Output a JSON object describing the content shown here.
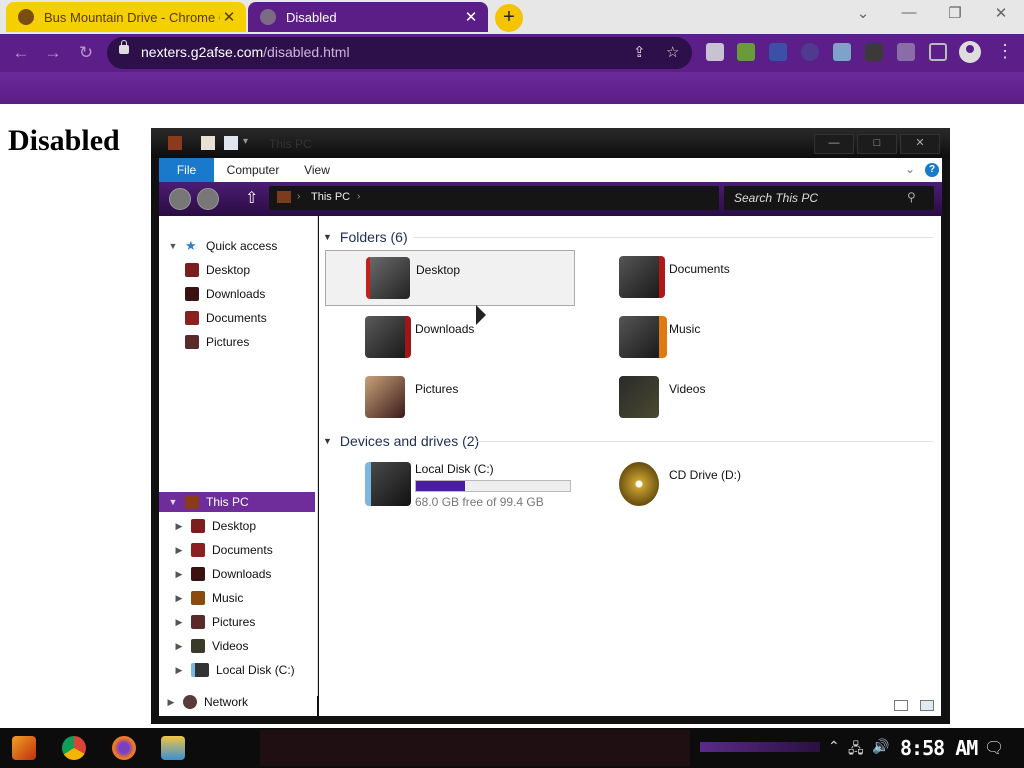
{
  "browser": {
    "tabs": [
      {
        "title": "Bus Mountain Drive - Chrome 6",
        "close": "✕"
      },
      {
        "title": "Disabled",
        "close": "✕"
      }
    ],
    "new_tab": "+",
    "window_controls": {
      "dropdown": "⌄",
      "minimize": "—",
      "restore": "❐",
      "close": "✕"
    },
    "nav": {
      "back": "←",
      "forward": "→",
      "reload": "↻"
    },
    "url_host": "nexters.g2afse.com",
    "url_path": "/disabled.html",
    "omnibox_icons": {
      "share": "⇪",
      "bookmark": "☆"
    },
    "colors": {
      "active_tab": "#5b1e87",
      "inactive_tab": "#f5d000",
      "toolbar": "#5c1f8a"
    }
  },
  "page": {
    "heading": "Disabled"
  },
  "explorer": {
    "title": "This PC",
    "window_buttons": {
      "minimize": "—",
      "maximize": "□",
      "close": "✕"
    },
    "ribbon_tabs": [
      "File",
      "Computer",
      "View"
    ],
    "help": "?",
    "breadcrumb": "This PC",
    "search_placeholder": "Search This PC",
    "nav": {
      "quick_access": "Quick access",
      "quick_items": [
        "Desktop",
        "Downloads",
        "Documents",
        "Pictures"
      ],
      "this_pc": "This PC",
      "pc_items": [
        "Desktop",
        "Documents",
        "Downloads",
        "Music",
        "Pictures",
        "Videos",
        "Local Disk (C:)"
      ],
      "network": "Network"
    },
    "folders_header": "Folders (6)",
    "folders": [
      "Desktop",
      "Documents",
      "Downloads",
      "Music",
      "Pictures",
      "Videos"
    ],
    "devices_header": "Devices and drives (2)",
    "drives": [
      {
        "name": "Local Disk (C:)",
        "free_text": "68.0 GB free of 99.4 GB",
        "used_fraction": 0.32
      },
      {
        "name": "CD Drive (D:)"
      }
    ]
  },
  "taskbar": {
    "clock": "8:58 AM",
    "apps": [
      "start-icon",
      "chrome-icon",
      "firefox-icon",
      "file-explorer-icon"
    ]
  }
}
